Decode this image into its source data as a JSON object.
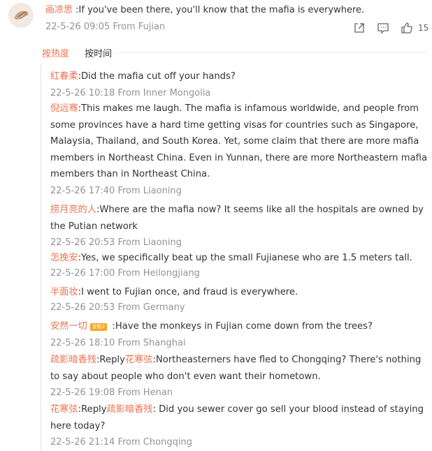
{
  "main_comment": {
    "username": "画凉思",
    "text": " :If you've been there, you'll know that the mafia is everywhere.",
    "meta": "22-5-26 09:05 From Fujian",
    "like_count": "15",
    "action_icons": [
      "share-icon",
      "comment-icon",
      "like-icon"
    ]
  },
  "tabs": {
    "hot": "按热度",
    "time": "按时间"
  },
  "replies": [
    {
      "username": "红春柔",
      "text": ":Did the mafia cut off your hands?",
      "meta": "22-5-26 10:18 From Inner Mongolia"
    },
    {
      "username": "倪远骞",
      "text": ":This makes me laugh. The mafia is infamous worldwide, and people from some provinces have a hard time getting visas for countries such as Singapore, Malaysia, Thailand, and South Korea. Yet, some claim that there are more mafia members in Northeast China. Even in Yunnan, there are more Northeastern mafia members than in Northeast China.",
      "meta": "22-5-26 17:40 From Liaoning"
    },
    {
      "username": "捞月亮的人",
      "text": ":Where are the mafia now? It seems like all the hospitals are owned by the Putian network",
      "meta": "22-5-26 20:53 From Liaoning"
    },
    {
      "username": "怎挽安",
      "text": ":Yes, we specifically beat up the small Fujianese who are 1.5 meters tall.",
      "meta": "22-5-26 17:00 From Heilongjiang"
    },
    {
      "username": "半面妆",
      "text": ":I went to Fujian once, and fraud is everywhere.",
      "meta": "22-5-26 20:53 From Germany"
    },
    {
      "username": "安然一切",
      "badge": "金粉2",
      "text": " :Have the monkeys in Fujian come down from the trees?",
      "meta": "22-5-26 18:10 From Shanghai"
    },
    {
      "username": "疏影暗香残",
      "reply_word": ":Reply",
      "reply_target": "花寒弦",
      "text": ":Northeasterners have fled to Chongqing? There's nothing to say about people who don't even want their hometown.",
      "meta": "22-5-26 19:08 From Henan"
    },
    {
      "username": "花寒弦",
      "reply_word": ":Reply",
      "reply_target": "疏影暗香残",
      "text": ": Did you sewer cover go sell your blood instead of staying here today?",
      "meta": "22-5-26 21:14 From Chongqing"
    }
  ],
  "colors": {
    "username": "#eb7350",
    "meta": "#939393",
    "text": "#333333",
    "badge": "#f6a623"
  }
}
